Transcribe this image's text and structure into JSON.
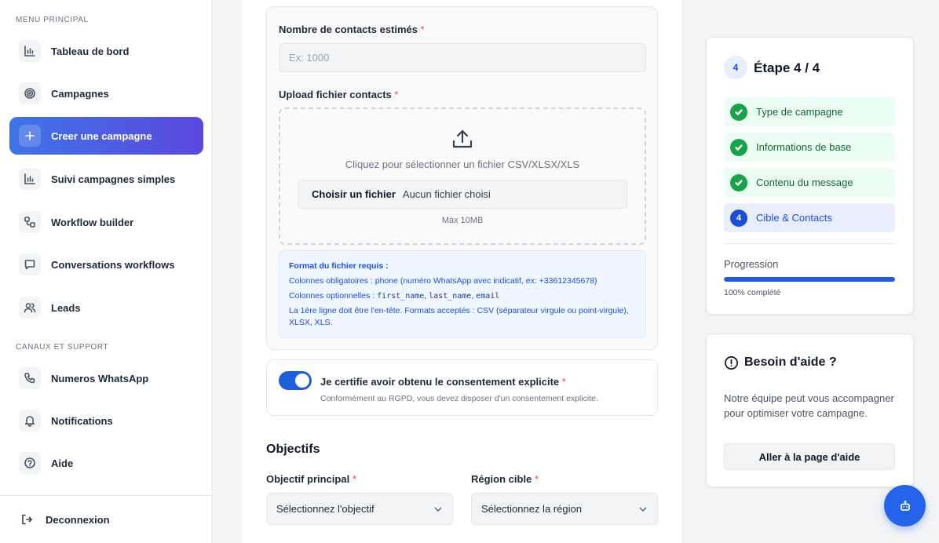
{
  "sidebar": {
    "section_main": "MENU PRINCIPAL",
    "section_support": "CANAUX ET SUPPORT",
    "items": [
      {
        "label": "Tableau de bord",
        "icon": "bar-chart-icon"
      },
      {
        "label": "Campagnes",
        "icon": "target-icon"
      },
      {
        "label": "Creer une campagne",
        "icon": "plus-icon",
        "active": true
      },
      {
        "label": "Suivi campagnes simples",
        "icon": "bar-chart-icon"
      },
      {
        "label": "Workflow builder",
        "icon": "workflow-icon"
      },
      {
        "label": "Conversations workflows",
        "icon": "message-icon"
      },
      {
        "label": "Leads",
        "icon": "users-icon"
      }
    ],
    "support_items": [
      {
        "label": "Numeros WhatsApp",
        "icon": "phone-icon"
      },
      {
        "label": "Notifications",
        "icon": "bell-icon"
      },
      {
        "label": "Aide",
        "icon": "help-circle-icon"
      }
    ],
    "logout_label": "Deconnexion"
  },
  "form": {
    "contacts_label": "Nombre de contacts estimés",
    "contacts_placeholder": "Ex: 1000",
    "upload_label": "Upload fichier contacts",
    "upload_hint": "Cliquez pour sélectionner un fichier CSV/XLSX/XLS",
    "choose_file_button": "Choisir un fichier",
    "no_file_text": "Aucun fichier choisi",
    "max_size": "Max 10MB",
    "format_title": "Format du fichier requis :",
    "format_required": "Colonnes obligatoires : phone (numéro WhatsApp avec indicatif, ex: +33612345678)",
    "format_optional_prefix": "Colonnes optionnelles : ",
    "format_optional_cols": [
      "first_name",
      "last_name",
      "email"
    ],
    "format_note": "La 1ère ligne doit être l'en-tête. Formats acceptés : CSV (séparateur virgule ou point-virgule), XLSX, XLS.",
    "consent_label": "Je certifie avoir obtenu le consentement explicite",
    "consent_hint": "Conformément au RGPD, vous devez disposer d'un consentement explicite.",
    "consent_checked": true,
    "objectives_heading": "Objectifs",
    "objective_label": "Objectif principal",
    "objective_value": "Sélectionnez l'objectif",
    "region_label": "Région cible",
    "region_value": "Sélectionnez la région",
    "required_mark": "*"
  },
  "progress_panel": {
    "step_number": "4",
    "step_title": "Étape 4 / 4",
    "steps": [
      {
        "label": "Type de campagne",
        "status": "done"
      },
      {
        "label": "Informations de base",
        "status": "done"
      },
      {
        "label": "Contenu du message",
        "status": "done"
      },
      {
        "label": "Cible & Contacts",
        "status": "current",
        "number": "4"
      }
    ],
    "progress_label": "Progression",
    "progress_value": 1.0,
    "progress_text": "100% complété"
  },
  "help_panel": {
    "title": "Besoin d'aide ?",
    "text": "Notre équipe peut vous accompagner pour optimiser votre campagne.",
    "button": "Aller à la page d'aide"
  },
  "colors": {
    "accent": "#1d5fd8",
    "active_gradient_start": "#3f74e8",
    "active_gradient_end": "#5b47dd",
    "success": "#16a34a",
    "required": "#ef4444"
  }
}
